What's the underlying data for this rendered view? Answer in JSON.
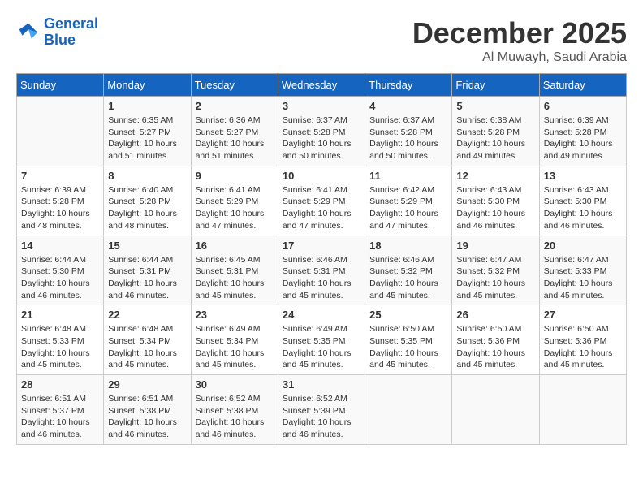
{
  "logo": {
    "line1": "General",
    "line2": "Blue"
  },
  "title": "December 2025",
  "location": "Al Muwayh, Saudi Arabia",
  "days_of_week": [
    "Sunday",
    "Monday",
    "Tuesday",
    "Wednesday",
    "Thursday",
    "Friday",
    "Saturday"
  ],
  "weeks": [
    [
      {
        "day": "",
        "info": ""
      },
      {
        "day": "1",
        "info": "Sunrise: 6:35 AM\nSunset: 5:27 PM\nDaylight: 10 hours\nand 51 minutes."
      },
      {
        "day": "2",
        "info": "Sunrise: 6:36 AM\nSunset: 5:27 PM\nDaylight: 10 hours\nand 51 minutes."
      },
      {
        "day": "3",
        "info": "Sunrise: 6:37 AM\nSunset: 5:28 PM\nDaylight: 10 hours\nand 50 minutes."
      },
      {
        "day": "4",
        "info": "Sunrise: 6:37 AM\nSunset: 5:28 PM\nDaylight: 10 hours\nand 50 minutes."
      },
      {
        "day": "5",
        "info": "Sunrise: 6:38 AM\nSunset: 5:28 PM\nDaylight: 10 hours\nand 49 minutes."
      },
      {
        "day": "6",
        "info": "Sunrise: 6:39 AM\nSunset: 5:28 PM\nDaylight: 10 hours\nand 49 minutes."
      }
    ],
    [
      {
        "day": "7",
        "info": "Sunrise: 6:39 AM\nSunset: 5:28 PM\nDaylight: 10 hours\nand 48 minutes."
      },
      {
        "day": "8",
        "info": "Sunrise: 6:40 AM\nSunset: 5:28 PM\nDaylight: 10 hours\nand 48 minutes."
      },
      {
        "day": "9",
        "info": "Sunrise: 6:41 AM\nSunset: 5:29 PM\nDaylight: 10 hours\nand 47 minutes."
      },
      {
        "day": "10",
        "info": "Sunrise: 6:41 AM\nSunset: 5:29 PM\nDaylight: 10 hours\nand 47 minutes."
      },
      {
        "day": "11",
        "info": "Sunrise: 6:42 AM\nSunset: 5:29 PM\nDaylight: 10 hours\nand 47 minutes."
      },
      {
        "day": "12",
        "info": "Sunrise: 6:43 AM\nSunset: 5:30 PM\nDaylight: 10 hours\nand 46 minutes."
      },
      {
        "day": "13",
        "info": "Sunrise: 6:43 AM\nSunset: 5:30 PM\nDaylight: 10 hours\nand 46 minutes."
      }
    ],
    [
      {
        "day": "14",
        "info": "Sunrise: 6:44 AM\nSunset: 5:30 PM\nDaylight: 10 hours\nand 46 minutes."
      },
      {
        "day": "15",
        "info": "Sunrise: 6:44 AM\nSunset: 5:31 PM\nDaylight: 10 hours\nand 46 minutes."
      },
      {
        "day": "16",
        "info": "Sunrise: 6:45 AM\nSunset: 5:31 PM\nDaylight: 10 hours\nand 45 minutes."
      },
      {
        "day": "17",
        "info": "Sunrise: 6:46 AM\nSunset: 5:31 PM\nDaylight: 10 hours\nand 45 minutes."
      },
      {
        "day": "18",
        "info": "Sunrise: 6:46 AM\nSunset: 5:32 PM\nDaylight: 10 hours\nand 45 minutes."
      },
      {
        "day": "19",
        "info": "Sunrise: 6:47 AM\nSunset: 5:32 PM\nDaylight: 10 hours\nand 45 minutes."
      },
      {
        "day": "20",
        "info": "Sunrise: 6:47 AM\nSunset: 5:33 PM\nDaylight: 10 hours\nand 45 minutes."
      }
    ],
    [
      {
        "day": "21",
        "info": "Sunrise: 6:48 AM\nSunset: 5:33 PM\nDaylight: 10 hours\nand 45 minutes."
      },
      {
        "day": "22",
        "info": "Sunrise: 6:48 AM\nSunset: 5:34 PM\nDaylight: 10 hours\nand 45 minutes."
      },
      {
        "day": "23",
        "info": "Sunrise: 6:49 AM\nSunset: 5:34 PM\nDaylight: 10 hours\nand 45 minutes."
      },
      {
        "day": "24",
        "info": "Sunrise: 6:49 AM\nSunset: 5:35 PM\nDaylight: 10 hours\nand 45 minutes."
      },
      {
        "day": "25",
        "info": "Sunrise: 6:50 AM\nSunset: 5:35 PM\nDaylight: 10 hours\nand 45 minutes."
      },
      {
        "day": "26",
        "info": "Sunrise: 6:50 AM\nSunset: 5:36 PM\nDaylight: 10 hours\nand 45 minutes."
      },
      {
        "day": "27",
        "info": "Sunrise: 6:50 AM\nSunset: 5:36 PM\nDaylight: 10 hours\nand 45 minutes."
      }
    ],
    [
      {
        "day": "28",
        "info": "Sunrise: 6:51 AM\nSunset: 5:37 PM\nDaylight: 10 hours\nand 46 minutes."
      },
      {
        "day": "29",
        "info": "Sunrise: 6:51 AM\nSunset: 5:38 PM\nDaylight: 10 hours\nand 46 minutes."
      },
      {
        "day": "30",
        "info": "Sunrise: 6:52 AM\nSunset: 5:38 PM\nDaylight: 10 hours\nand 46 minutes."
      },
      {
        "day": "31",
        "info": "Sunrise: 6:52 AM\nSunset: 5:39 PM\nDaylight: 10 hours\nand 46 minutes."
      },
      {
        "day": "",
        "info": ""
      },
      {
        "day": "",
        "info": ""
      },
      {
        "day": "",
        "info": ""
      }
    ]
  ]
}
